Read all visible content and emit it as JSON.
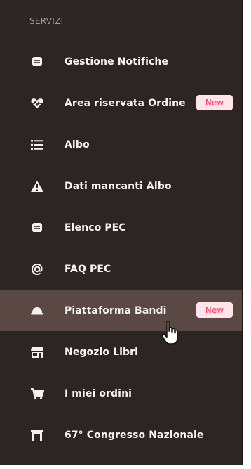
{
  "sidebar": {
    "section_title": "SERVIZI",
    "items": [
      {
        "label": "Gestione Notifiche",
        "icon": "envelope-icon"
      },
      {
        "label": "Area riservata Ordine",
        "icon": "heartbeat-icon",
        "badge": "New"
      },
      {
        "label": "Albo",
        "icon": "list-icon"
      },
      {
        "label": "Dati mancanti Albo",
        "icon": "warning-icon"
      },
      {
        "label": "Elenco PEC",
        "icon": "envelope-icon"
      },
      {
        "label": "FAQ PEC",
        "icon": "at-icon"
      },
      {
        "label": "Piattaforma Bandi",
        "icon": "hard-hat-icon",
        "badge": "New",
        "active": true
      },
      {
        "label": "Negozio Libri",
        "icon": "store-icon"
      },
      {
        "label": "I miei ordini",
        "icon": "cart-icon"
      },
      {
        "label": "67° Congresso Nazionale",
        "icon": "landmark-icon"
      }
    ]
  },
  "colors": {
    "sidebar_bg": "#2c2523",
    "active_item_bg": "#5a4845",
    "badge_bg": "#ffe4e9",
    "badge_text": "#ff3b62"
  },
  "cursor": {
    "icon": "hand-pointer-icon"
  }
}
